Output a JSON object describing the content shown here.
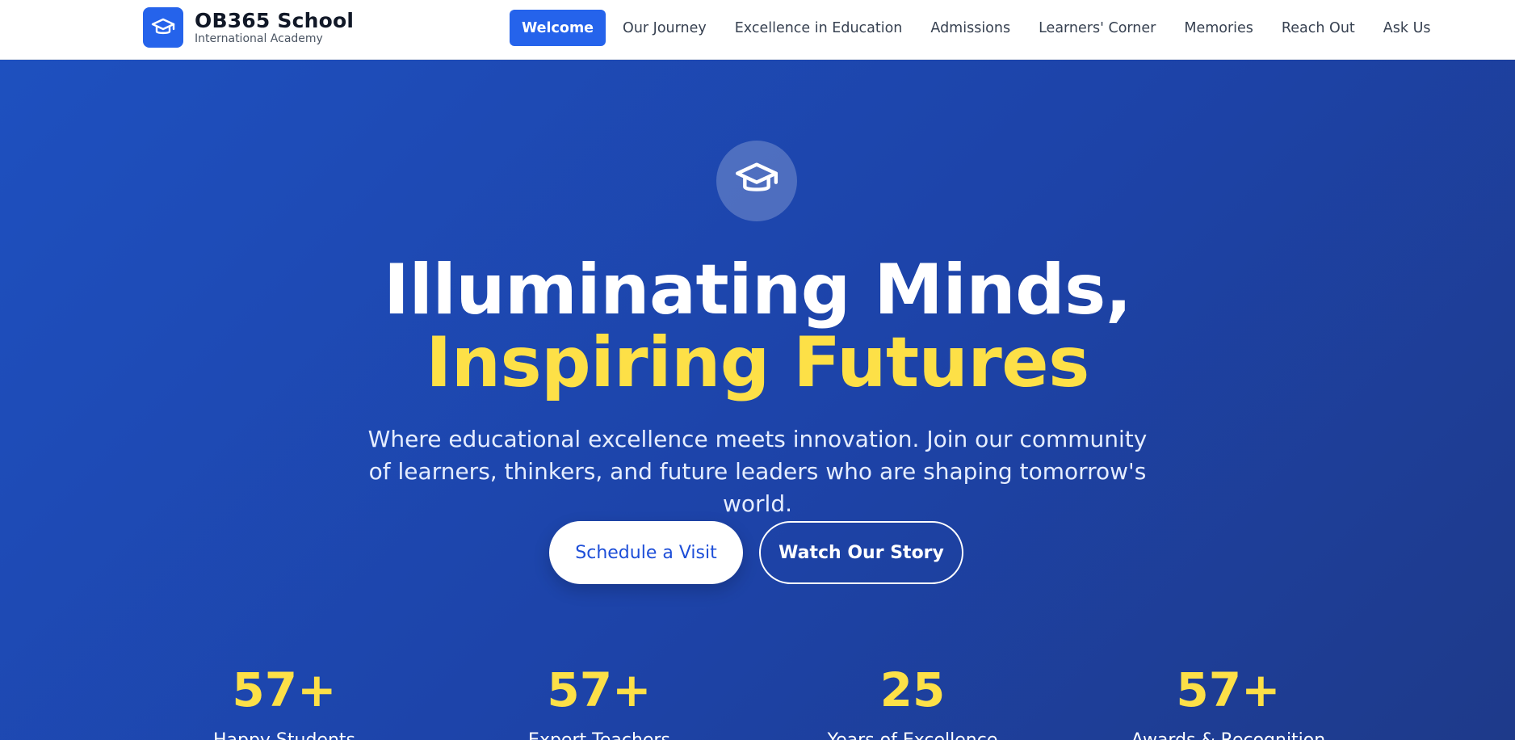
{
  "brand": {
    "name": "OB365 School",
    "subtitle": "International Academy",
    "logo_icon": "graduation-cap-icon"
  },
  "nav": {
    "items": [
      {
        "label": "Welcome",
        "active": true
      },
      {
        "label": "Our Journey",
        "active": false
      },
      {
        "label": "Excellence in Education",
        "active": false
      },
      {
        "label": "Admissions",
        "active": false
      },
      {
        "label": "Learners' Corner",
        "active": false
      },
      {
        "label": "Memories",
        "active": false
      },
      {
        "label": "Reach Out",
        "active": false
      },
      {
        "label": "Ask Us",
        "active": false
      }
    ]
  },
  "hero": {
    "badge_icon": "graduation-cap-icon",
    "title_line1": "Illuminating Minds,",
    "title_line2": "Inspiring Futures",
    "subtitle": "Where educational excellence meets innovation. Join our community of learners, thinkers, and future leaders who are shaping tomorrow's world.",
    "primary_button": "Schedule a Visit",
    "secondary_button": "Watch Our Story"
  },
  "stats": [
    {
      "value": "57+",
      "label": "Happy Students"
    },
    {
      "value": "57+",
      "label": "Expert Teachers"
    },
    {
      "value": "25",
      "label": "Years of Excellence"
    },
    {
      "value": "57+",
      "label": "Awards & Recognition"
    }
  ],
  "colors": {
    "primary": "#2563eb",
    "hero_bg": "#1e4bb8",
    "accent_yellow": "#fde047",
    "nav_text": "#374151"
  }
}
